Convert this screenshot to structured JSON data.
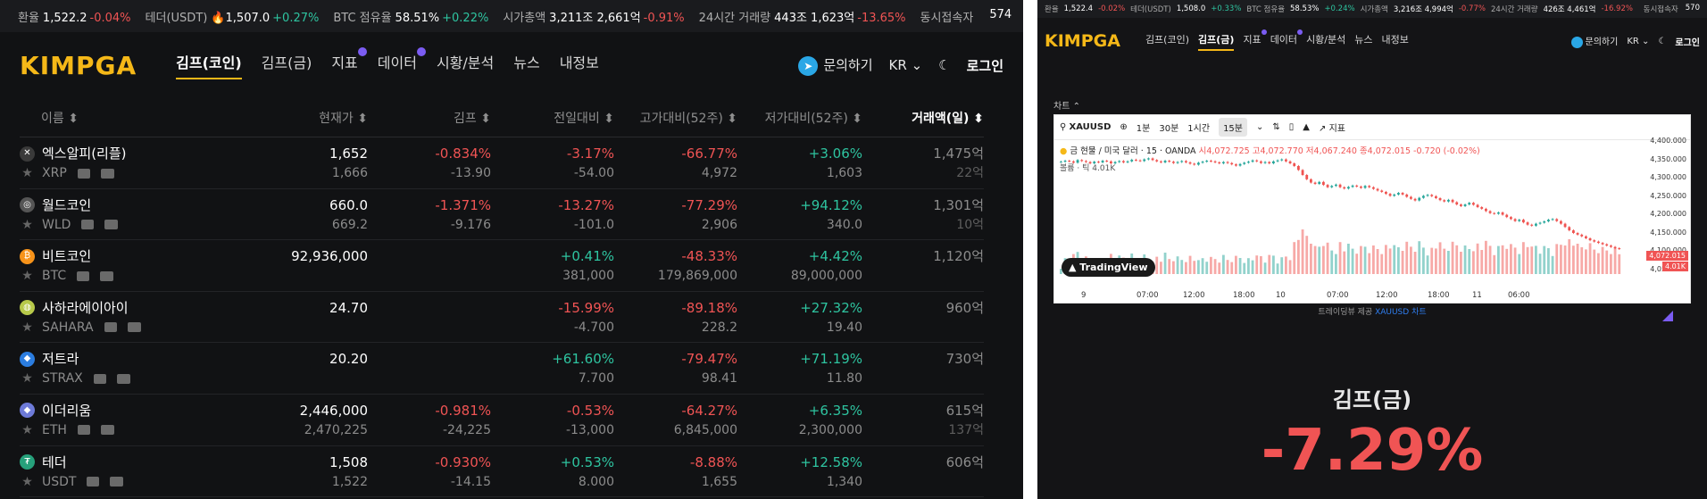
{
  "ticker": {
    "rate_label": "환율",
    "rate_value": "1,522.2",
    "rate_change": "-0.04%",
    "tether_label": "테더(USDT)",
    "tether_value": "1,507.0",
    "tether_change": "+0.27%",
    "btc_dom_label": "BTC 점유율",
    "btc_dom_value": "58.51%",
    "btc_dom_change": "+0.22%",
    "mcap_label": "시가총액",
    "mcap_value": "3,211조 2,661억",
    "mcap_change": "-0.91%",
    "vol_label": "24시간 거래량",
    "vol_value": "443조 1,623억",
    "vol_change": "-13.65%",
    "users_label": "동시접속자",
    "users_value": "574"
  },
  "header": {
    "logo": "KIMPGA",
    "nav": [
      "김프(코인)",
      "김프(금)",
      "지표",
      "데이터",
      "시황/분석",
      "뉴스",
      "내정보"
    ],
    "inquiry": "문의하기",
    "lang": "KR",
    "login": "로그인"
  },
  "table": {
    "columns": [
      "이름 ⬍",
      "현재가 ⬍",
      "김프 ⬍",
      "전일대비 ⬍",
      "고가대비(52주) ⬍",
      "저가대비(52주) ⬍",
      "거래액(일) ⬍"
    ],
    "rows": [
      {
        "name": "엑스알피(리플)",
        "symbol": "XRP",
        "price": "1,652",
        "price_sub": "1,666",
        "kimp": "-0.834%",
        "kimp_sub": "-13.90",
        "day": "-3.17%",
        "day_sub": "-54.00",
        "high": "-66.77%",
        "high_sub": "4,972",
        "low": "+3.06%",
        "low_sub": "1,603",
        "vol": "1,475억",
        "vol_sub": "22억",
        "icon": "xrp-icon"
      },
      {
        "name": "월드코인",
        "symbol": "WLD",
        "price": "660.0",
        "price_sub": "669.2",
        "kimp": "-1.371%",
        "kimp_sub": "-9.176",
        "day": "-13.27%",
        "day_sub": "-101.0",
        "high": "-77.29%",
        "high_sub": "2,906",
        "low": "+94.12%",
        "low_sub": "340.0",
        "vol": "1,301억",
        "vol_sub": "10억",
        "icon": "worldcoin-icon"
      },
      {
        "name": "비트코인",
        "symbol": "BTC",
        "price": "92,936,000",
        "price_sub": "",
        "kimp": "",
        "kimp_sub": "",
        "day": "+0.41%",
        "day_sub": "381,000",
        "high": "-48.33%",
        "high_sub": "179,869,000",
        "low": "+4.42%",
        "low_sub": "89,000,000",
        "vol": "1,120억",
        "vol_sub": "",
        "icon": "bitcoin-icon"
      },
      {
        "name": "사하라에이아이",
        "symbol": "SAHARA",
        "price": "24.70",
        "price_sub": "",
        "kimp": "",
        "kimp_sub": "",
        "day": "-15.99%",
        "day_sub": "-4.700",
        "high": "-89.18%",
        "high_sub": "228.2",
        "low": "+27.32%",
        "low_sub": "19.40",
        "vol": "960억",
        "vol_sub": "",
        "icon": "sahara-icon"
      },
      {
        "name": "저트라",
        "symbol": "STRAX",
        "price": "20.20",
        "price_sub": "",
        "kimp": "",
        "kimp_sub": "",
        "day": "+61.60%",
        "day_sub": "7.700",
        "high": "-79.47%",
        "high_sub": "98.41",
        "low": "+71.19%",
        "low_sub": "11.80",
        "vol": "730억",
        "vol_sub": "",
        "icon": "stratis-icon"
      },
      {
        "name": "이더리움",
        "symbol": "ETH",
        "price": "2,446,000",
        "price_sub": "2,470,225",
        "kimp": "-0.981%",
        "kimp_sub": "-24,225",
        "day": "-0.53%",
        "day_sub": "-13,000",
        "high": "-64.27%",
        "high_sub": "6,845,000",
        "low": "+6.35%",
        "low_sub": "2,300,000",
        "vol": "615억",
        "vol_sub": "137억",
        "icon": "ethereum-icon"
      },
      {
        "name": "테더",
        "symbol": "USDT",
        "price": "1,508",
        "price_sub": "1,522",
        "kimp": "-0.930%",
        "kimp_sub": "-14.15",
        "day": "+0.53%",
        "day_sub": "8.000",
        "high": "-8.88%",
        "high_sub": "1,655",
        "low": "+12.58%",
        "low_sub": "1,340",
        "vol": "606억",
        "vol_sub": "",
        "icon": "tether-icon"
      }
    ]
  },
  "right": {
    "ticker": {
      "rate_label": "환율",
      "rate_value": "1,522.4",
      "rate_change": "-0.02%",
      "tether_label": "테더(USDT)",
      "tether_value": "1,508.0",
      "tether_change": "+0.33%",
      "btc_dom_label": "BTC 점유율",
      "btc_dom_value": "58.53%",
      "btc_dom_change": "+0.24%",
      "mcap_label": "시가총액",
      "mcap_value": "3,216조 4,994억",
      "mcap_change": "-0.77%",
      "vol_label": "24시간 거래량",
      "vol_value": "426조 4,461억",
      "vol_change": "-16.92%",
      "users_label": "동시접속자",
      "users_value": "570"
    },
    "header": {
      "logo": "KIMPGA",
      "nav": [
        "김프(코인)",
        "김프(금)",
        "지표",
        "데이터",
        "시황/분석",
        "뉴스",
        "내정보"
      ],
      "inquiry": "문의하기",
      "lang": "KR",
      "login": "로그인"
    },
    "chart_label": "차트 ⌃",
    "toolbar": {
      "symbol": "XAUUSD",
      "tf": [
        "1분",
        "30분",
        "1시간",
        "15분"
      ],
      "indicators": "지표"
    },
    "info": "금 현물 / 미국 달러 · 15 · OANDA",
    "ohlc": "시4,072.725 고4,072.770 저4,067.240 종4,072.015 -0.720 (-0.02%)",
    "vol_line": "볼륨 · 틱  4.01K",
    "tv_badge": "TradingView",
    "yticks": [
      "4,400.000",
      "4,350.000",
      "4,300.000",
      "4,250.000",
      "4,200.000",
      "4,150.000",
      "4,100.000",
      "4,050.000"
    ],
    "price_tag": "4,072.015",
    "vol_tag": "4.01K",
    "xticks": [
      "9",
      "07:00",
      "12:00",
      "18:00",
      "10",
      "07:00",
      "12:00",
      "18:00",
      "11",
      "06:00"
    ],
    "credit_text": "트레이딩뷰 제공",
    "credit_link": "XAUUSD 차트",
    "big_title": "김프(금)",
    "big_pct": "-7.29%",
    "series_close": [
      4335,
      4338,
      4336,
      4332,
      4340,
      4337,
      4334,
      4330,
      4335,
      4333,
      4338,
      4336,
      4330,
      4334,
      4337,
      4333,
      4336,
      4341,
      4339,
      4337,
      4342,
      4345,
      4340,
      4336,
      4333,
      4338,
      4335,
      4331,
      4334,
      4337,
      4333,
      4329,
      4326,
      4332,
      4335,
      4338,
      4336,
      4333,
      4330,
      4334,
      4331,
      4327,
      4323,
      4328,
      4332,
      4335,
      4339,
      4336,
      4331,
      4334,
      4330,
      4336,
      4339,
      4342,
      4336,
      4330,
      4322,
      4310,
      4295,
      4282,
      4272,
      4268,
      4274,
      4265,
      4258,
      4262,
      4266,
      4258,
      4254,
      4259,
      4263,
      4260,
      4256,
      4262,
      4258,
      4253,
      4248,
      4244,
      4238,
      4232,
      4236,
      4241,
      4236,
      4229,
      4223,
      4218,
      4226,
      4232,
      4235,
      4231,
      4225,
      4219,
      4215,
      4220,
      4213,
      4206,
      4201,
      4206,
      4211,
      4205,
      4198,
      4193,
      4186,
      4180,
      4178,
      4182,
      4175,
      4168,
      4162,
      4156,
      4160,
      4152,
      4145,
      4142,
      4148,
      4151,
      4155,
      4160,
      4162,
      4156,
      4148,
      4138,
      4128,
      4120,
      4115,
      4110,
      4104,
      4098,
      4094,
      4090,
      4086,
      4082,
      4078,
      4074,
      4072
    ]
  }
}
